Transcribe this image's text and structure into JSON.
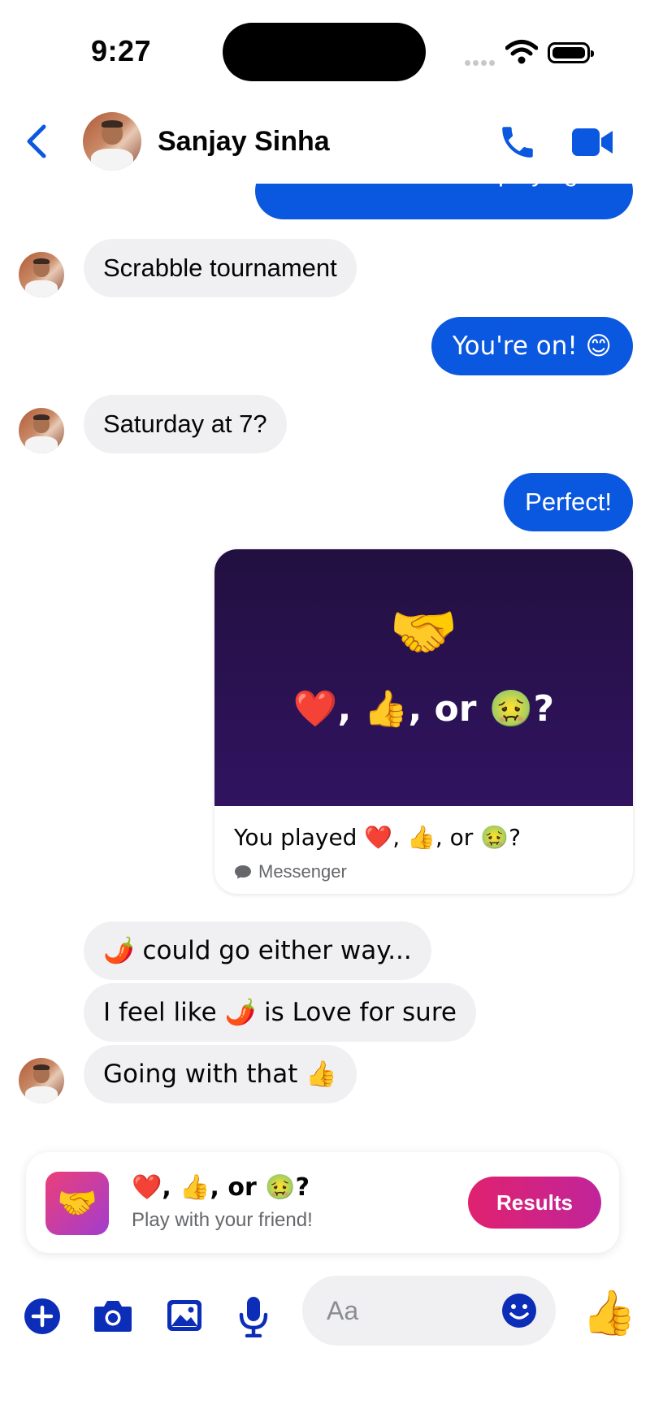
{
  "status_bar": {
    "time": "9:27"
  },
  "header": {
    "contact_name": "Sanjay Sinha"
  },
  "messages": [
    {
      "from": "me",
      "text": "I'm in! What are we playing?"
    },
    {
      "from": "them",
      "text": "Scrabble tournament"
    },
    {
      "from": "me",
      "text": "You're on! 😊"
    },
    {
      "from": "them",
      "text": "Saturday at 7?"
    },
    {
      "from": "me",
      "text": "Perfect!"
    },
    {
      "from": "them",
      "text": "🌶️ could go either way..."
    },
    {
      "from": "them",
      "text": "I feel like 🌶️ is Love for sure"
    },
    {
      "from": "them",
      "text": "Going with that 👍"
    }
  ],
  "game_card": {
    "hero_emoji": "🤝",
    "hero_question": "❤️, 👍, or 🤢?",
    "title": "You played ❤️, 👍, or 🤢?",
    "source": "Messenger"
  },
  "game_banner": {
    "icon_emoji": "🤝",
    "title": "❤️, 👍, or 🤢?",
    "subtitle": "Play with your friend!",
    "button_label": "Results"
  },
  "composer": {
    "placeholder": "Aa",
    "like_emoji": "👍"
  },
  "colors": {
    "accent": "#0a57e0",
    "incoming_bubble": "#f0f0f3",
    "card_background": "#2a1150",
    "results_button": "#e0226f"
  }
}
